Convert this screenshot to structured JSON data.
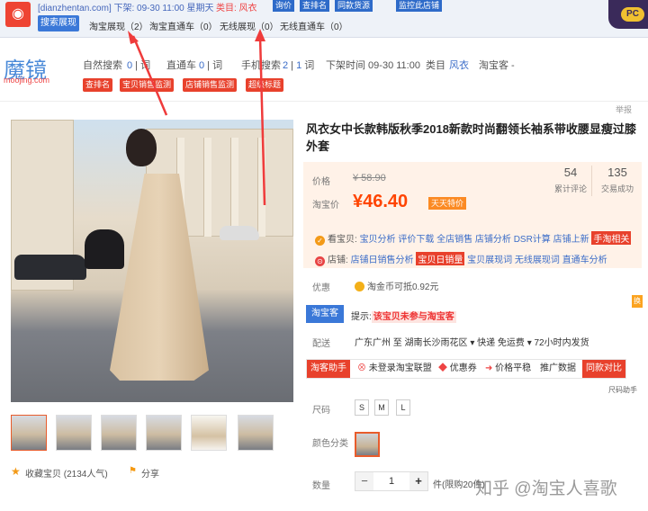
{
  "topbar": {
    "url": "[dianzhentan.com] 下架: 09-30 11:00 星期天",
    "category_text": "类目: 风衣",
    "buttons": [
      "询价",
      "查排名",
      "同款货源",
      "监控此店铺"
    ],
    "active_tab": "搜索展现",
    "tabs": [
      "淘宝展现（2）",
      "淘宝直通车（0）",
      "无线展现（0）",
      "无线直通车（0）"
    ],
    "pc_badge": "PC"
  },
  "brand": {
    "name": "魔镜",
    "sub": "moojing.com"
  },
  "stats": [
    "自然搜索",
    "0",
    "词",
    "直通车",
    "0",
    "词",
    "手机搜索",
    "2",
    "1",
    "词",
    "下架时间 09-30 11:00",
    "类目",
    "风衣",
    "淘宝客 -"
  ],
  "red_tags": [
    "查排名",
    "宝贝销售监测",
    "店铺销售监测",
    "超级标题"
  ],
  "report": "举报",
  "product": {
    "title": "风衣女中长款韩版秋季2018新款时尚翻领长袖系带收腰显瘦过膝外套",
    "price_label": "价格",
    "old_price": "¥ 58.90",
    "tb_price_label": "淘宝价",
    "price": "¥46.40",
    "price_tag": "天天特价",
    "reviews_count": "54",
    "reviews_label": "累计评论",
    "sales_count": "135",
    "sales_label": "交易成功",
    "shop_line_label": "看宝贝:",
    "shop_line_items": [
      "宝贝分析",
      "评价下载",
      "全店销售",
      "店铺分析",
      "DSR计算",
      "店铺上新"
    ],
    "shop_line_badge": "手淘相关",
    "store_line_label": "店铺:",
    "store_line_items": [
      "店铺日销售分析",
      "无线展现词",
      "直通车分析"
    ],
    "store_line_badge": "宝贝日销量",
    "store_line_middle": "宝贝展现词",
    "discount_label": "优惠",
    "discount_text": "淘金币可抵0.92元",
    "tbk_button": "淘宝客",
    "tbk_note_prefix": "提示:",
    "tbk_note": "该宝贝未参与淘宝客",
    "side_btn": "换",
    "ship_label": "配送",
    "ship_text": "广东广州 至  湖南长沙雨花区 ▾   快递 免运费 ▾   72小时内发货",
    "toolbar": [
      "淘客助手",
      "未登录淘宝联盟",
      "优惠券",
      "价格平稳",
      "推广数据",
      "同款对比"
    ],
    "size_chart": "尺码助手",
    "size_label": "尺码",
    "sizes": [
      "S",
      "M",
      "L"
    ],
    "color_label": "颜色分类",
    "qty_label": "数量",
    "qty": "1",
    "qty_minus": "−",
    "qty_plus": "+",
    "stock": "件(限购20件)",
    "fav": "收藏宝贝 (2134人气)",
    "share": "分享",
    "star_icon": "★",
    "share_icon": "⚑"
  },
  "watermark": "知乎 @淘宝人喜歌",
  "colors": {
    "accent_blue": "#3a78d8",
    "red": "#e8412c",
    "price": "#ff4400",
    "arrow": "#ef3b3b"
  }
}
